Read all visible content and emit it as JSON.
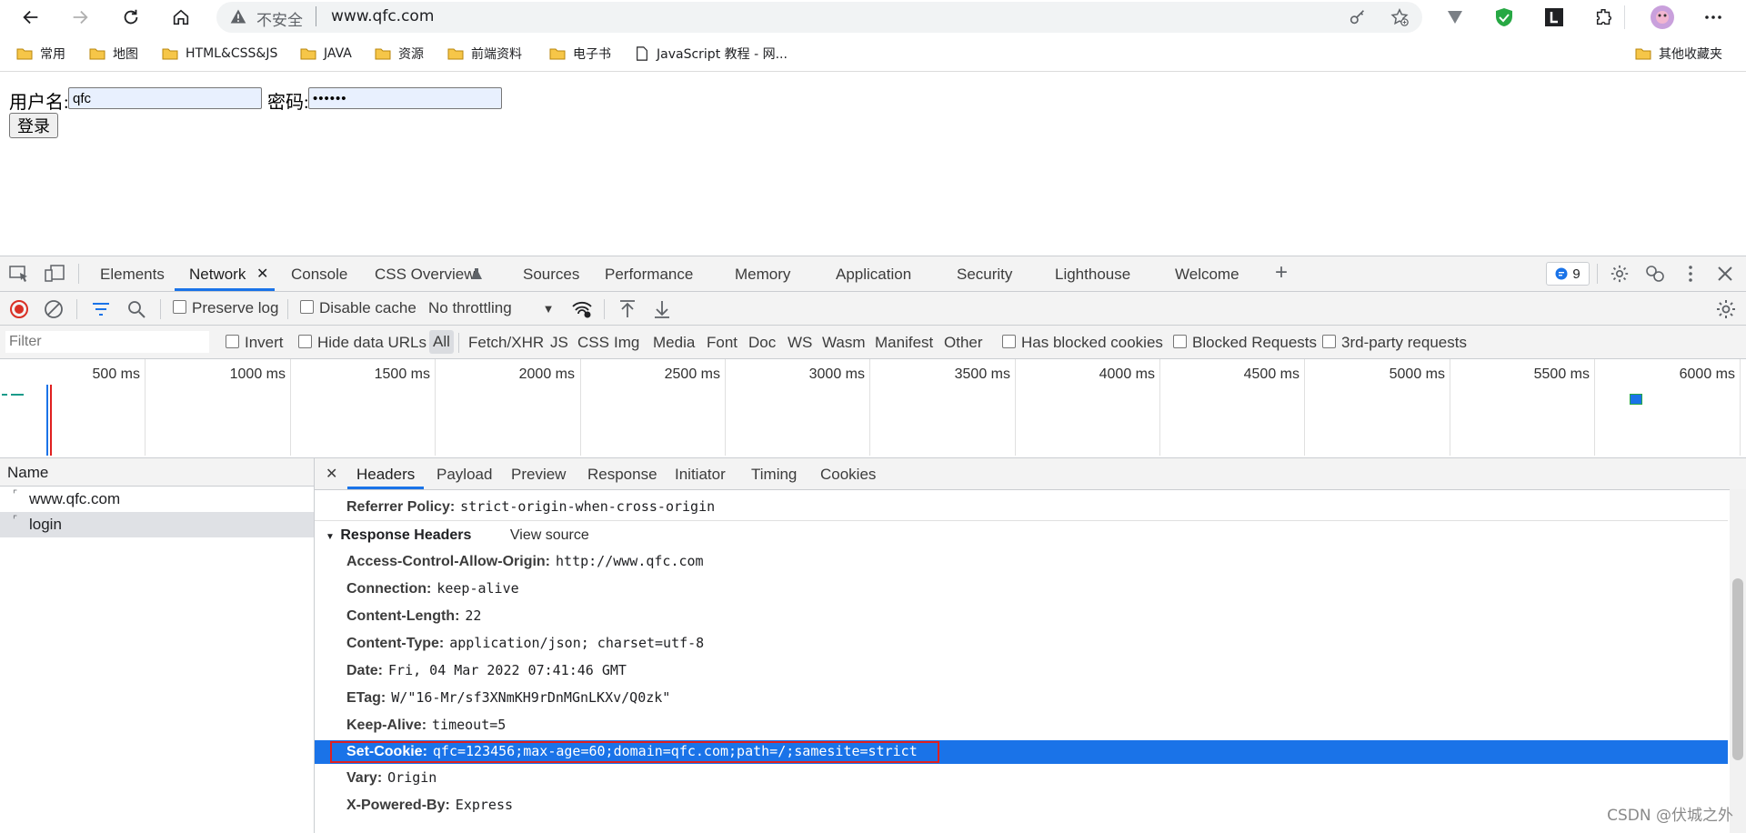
{
  "browser": {
    "address": {
      "insecure_label": "不安全",
      "url": "www.qfc.com"
    },
    "icons": [
      "back-icon",
      "forward-icon",
      "reload-icon",
      "home-icon",
      "key-icon",
      "favorite-add-icon",
      "v-extension-icon",
      "shield-extension-icon",
      "l-extension-icon",
      "extensions-icon",
      "profile-avatar",
      "more-icon"
    ]
  },
  "bookmarks": {
    "items": [
      "常用",
      "地图",
      "HTML&CSS&JS",
      "JAVA",
      "资源",
      "前端资料",
      "电子书",
      "JavaScript 教程 - 网..."
    ],
    "other": "其他收藏夹"
  },
  "page": {
    "username_label": "用户名:",
    "username_value": "qfc",
    "password_label": "密码:",
    "password_value": "••••••",
    "login_button": "登录"
  },
  "devtools": {
    "tabs": [
      "Elements",
      "Network",
      "Console",
      "CSS Overview",
      "Sources",
      "Performance",
      "Memory",
      "Application",
      "Security",
      "Lighthouse",
      "Welcome"
    ],
    "active_tab": "Network",
    "issues_count": "9",
    "network_toolbar": {
      "preserve_log": "Preserve log",
      "disable_cache": "Disable cache",
      "throttling": "No throttling"
    },
    "filter_bar": {
      "placeholder": "Filter",
      "invert": "Invert",
      "hide_data_urls": "Hide data URLs",
      "types": [
        "All",
        "Fetch/XHR",
        "JS",
        "CSS",
        "Img",
        "Media",
        "Font",
        "Doc",
        "WS",
        "Wasm",
        "Manifest",
        "Other"
      ],
      "has_blocked_cookies": "Has blocked cookies",
      "blocked_requests": "Blocked Requests",
      "third_party": "3rd-party requests"
    },
    "timeline": {
      "ticks": [
        "500 ms",
        "1000 ms",
        "1500 ms",
        "2000 ms",
        "2500 ms",
        "3000 ms",
        "3500 ms",
        "4000 ms",
        "4500 ms",
        "5000 ms",
        "5500 ms",
        "6000 ms"
      ]
    },
    "requests": {
      "column": "Name",
      "rows": [
        "www.qfc.com",
        "login"
      ],
      "selected": "login"
    },
    "detail": {
      "tabs": [
        "Headers",
        "Payload",
        "Preview",
        "Response",
        "Initiator",
        "Timing",
        "Cookies"
      ],
      "active_tab": "Headers",
      "referrer_policy": {
        "name": "Referrer Policy:",
        "value": "strict-origin-when-cross-origin"
      },
      "response_headers_title": "Response Headers",
      "view_source": "View source",
      "headers": [
        {
          "name": "Access-Control-Allow-Origin:",
          "value": "http://www.qfc.com"
        },
        {
          "name": "Connection:",
          "value": "keep-alive"
        },
        {
          "name": "Content-Length:",
          "value": "22"
        },
        {
          "name": "Content-Type:",
          "value": "application/json; charset=utf-8"
        },
        {
          "name": "Date:",
          "value": "Fri, 04 Mar 2022 07:41:46 GMT"
        },
        {
          "name": "ETag:",
          "value": "W/\"16-Mr/sf3XNmKH9rDnMGnLKXv/Q0zk\""
        },
        {
          "name": "Keep-Alive:",
          "value": "timeout=5"
        },
        {
          "name": "Set-Cookie:",
          "value": "qfc=123456;max-age=60;domain=qfc.com;path=/;samesite=strict"
        },
        {
          "name": "Vary:",
          "value": "Origin"
        },
        {
          "name": "X-Powered-By:",
          "value": "Express"
        }
      ],
      "highlighted_header": "Set-Cookie:"
    }
  },
  "watermark": "CSDN @伏城之外",
  "colors": {
    "accent": "#1a73e8",
    "highlight_border": "#e02020",
    "record": "#d93025"
  }
}
